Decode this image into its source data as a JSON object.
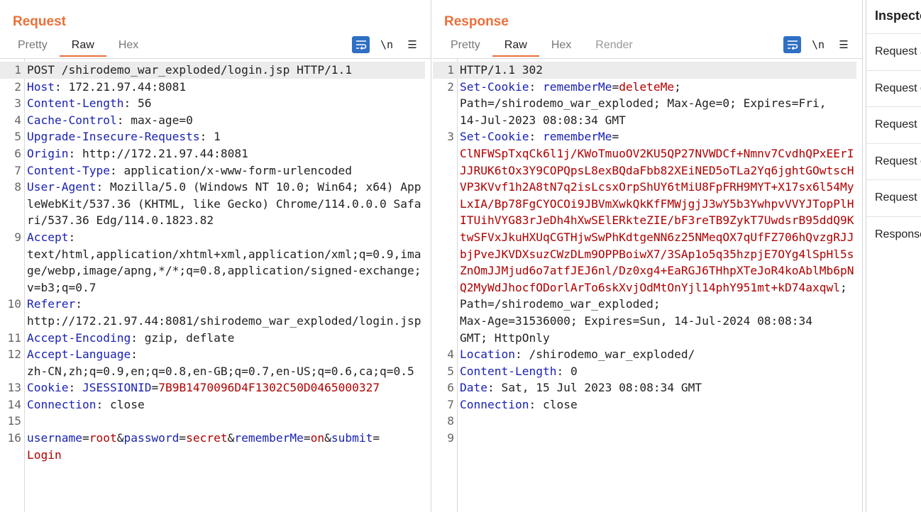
{
  "request": {
    "title": "Request",
    "tabs": [
      "Pretty",
      "Raw",
      "Hex"
    ],
    "active_tab": "Raw",
    "tools": {
      "newline": "\\n",
      "menu": "☰"
    },
    "lines": [
      {
        "n": "1",
        "hl": true,
        "segs": [
          [
            "v",
            "POST /shirodemo_war_exploded/login.jsp HTTP/1.1"
          ]
        ]
      },
      {
        "n": "2",
        "segs": [
          [
            "k",
            "Host"
          ],
          [
            "v",
            ": 172.21.97.44:8081"
          ]
        ]
      },
      {
        "n": "3",
        "segs": [
          [
            "k",
            "Content-Length"
          ],
          [
            "v",
            ": 56"
          ]
        ]
      },
      {
        "n": "4",
        "segs": [
          [
            "k",
            "Cache-Control"
          ],
          [
            "v",
            ": max-age=0"
          ]
        ]
      },
      {
        "n": "5",
        "segs": [
          [
            "k",
            "Upgrade-Insecure-Requests"
          ],
          [
            "v",
            ": 1"
          ]
        ]
      },
      {
        "n": "6",
        "segs": [
          [
            "k",
            "Origin"
          ],
          [
            "v",
            ": http://172.21.97.44:8081"
          ]
        ]
      },
      {
        "n": "7",
        "segs": [
          [
            "k",
            "Content-Type"
          ],
          [
            "v",
            ": application/x-www-form-urlencoded"
          ]
        ]
      },
      {
        "n": "8",
        "segs": [
          [
            "k",
            "User-Agent"
          ],
          [
            "v",
            ": Mozilla/5.0 (Windows NT 10.0; Win64; x64) AppleWebKit/537.36 (KHTML, like Gecko) Chrome/114.0.0.0 Safari/537.36 Edg/114.0.1823.82"
          ]
        ]
      },
      {
        "n": "9",
        "segs": [
          [
            "k",
            "Accept"
          ],
          [
            "v",
            ":\ntext/html,application/xhtml+xml,application/xml;q=0.9,image/webp,image/apng,*/*;q=0.8,application/signed-exchange;v=b3;q=0.7"
          ]
        ]
      },
      {
        "n": "10",
        "segs": [
          [
            "k",
            "Referer"
          ],
          [
            "v",
            ":\nhttp://172.21.97.44:8081/shirodemo_war_exploded/login.jsp"
          ]
        ]
      },
      {
        "n": "11",
        "segs": [
          [
            "k",
            "Accept-Encoding"
          ],
          [
            "v",
            ": gzip, deflate"
          ]
        ]
      },
      {
        "n": "12",
        "segs": [
          [
            "k",
            "Accept-Language"
          ],
          [
            "v",
            ":\nzh-CN,zh;q=0.9,en;q=0.8,en-GB;q=0.7,en-US;q=0.6,ca;q=0.5"
          ]
        ]
      },
      {
        "n": "13",
        "segs": [
          [
            "k",
            "Cookie"
          ],
          [
            "v",
            ": "
          ],
          [
            "k",
            "JSESSIONID"
          ],
          [
            "v",
            "="
          ],
          [
            "r",
            "7B9B1470096D4F1302C50D0465000327"
          ]
        ]
      },
      {
        "n": "14",
        "segs": [
          [
            "k",
            "Connection"
          ],
          [
            "v",
            ": close"
          ]
        ]
      },
      {
        "n": "15",
        "segs": [
          [
            "v",
            ""
          ]
        ]
      },
      {
        "n": "16",
        "segs": [
          [
            "k",
            "username"
          ],
          [
            "v",
            "="
          ],
          [
            "r",
            "root"
          ],
          [
            "v",
            "&"
          ],
          [
            "k",
            "password"
          ],
          [
            "v",
            "="
          ],
          [
            "r",
            "secret"
          ],
          [
            "v",
            "&"
          ],
          [
            "k",
            "rememberMe"
          ],
          [
            "v",
            "="
          ],
          [
            "r",
            "on"
          ],
          [
            "v",
            "&"
          ],
          [
            "k",
            "submit"
          ],
          [
            "v",
            "=\n"
          ],
          [
            "r",
            "Login"
          ]
        ]
      }
    ]
  },
  "response": {
    "title": "Response",
    "tabs": [
      "Pretty",
      "Raw",
      "Hex",
      "Render"
    ],
    "active_tab": "Raw",
    "tools": {
      "newline": "\\n",
      "menu": "☰"
    },
    "lines": [
      {
        "n": "1",
        "hl": true,
        "segs": [
          [
            "v",
            "HTTP/1.1 302"
          ]
        ]
      },
      {
        "n": "2",
        "segs": [
          [
            "k",
            "Set-Cookie"
          ],
          [
            "v",
            ": "
          ],
          [
            "k",
            "rememberMe"
          ],
          [
            "v",
            "="
          ],
          [
            "r",
            "deleteMe"
          ],
          [
            "v",
            ";\nPath=/shirodemo_war_exploded; Max-Age=0; Expires=Fri,\n14-Jul-2023 08:08:34 GMT"
          ]
        ]
      },
      {
        "n": "3",
        "segs": [
          [
            "k",
            "Set-Cookie"
          ],
          [
            "v",
            ": "
          ],
          [
            "k",
            "rememberMe"
          ],
          [
            "v",
            "=\n"
          ],
          [
            "r",
            "ClNFWSpTxqCk6l1j/KWoTmuoOV2KU5QP27NVWDCf+Nmnv7CvdhQPxEErIJJRUK6tOx3Y9COPQpsL8exBQdaFbb82XEiNED5oTLa2Yq6jghtGOwtscHVP3KVvf1h2A8tN7q2isLcsxOrpShUY6tMiU8FpFRH9MYT+X17sx6l54MyLxIA/Bp78FgCYOCOi9JBVmXwkQkKfFMWjgjJ3wY5b3YwhpvVVYJTopPlHITUihVYG83rJeDh4hXwSElERkteZIE/bF3reTB9ZykT7UwdsrB95ddQ9KtwSFVxJkuHXUqCGTHjwSwPhKdtgeNN6z25NMeqOX7qUfFZ706hQvzgRJJbjPveJKVDXsuzCWzDLm9OPPBoiwX7/3SAp1o5q35hzpjE7OYg4lSpHl5sZnOmJJMjud6o7atfJEJ6nl/Dz0xg4+EaRGJ6THhpXTeJoR4koAblMb6pNQ2MyWdJhocfODorlArTo6skXvjOdMtOnYjl14phY951mt+kD74axqwl"
          ],
          [
            "v",
            "; Path=/shirodemo_war_exploded;\nMax-Age=31536000; Expires=Sun, 14-Jul-2024 08:08:34\nGMT; HttpOnly"
          ]
        ]
      },
      {
        "n": "4",
        "segs": [
          [
            "k",
            "Location"
          ],
          [
            "v",
            ": /shirodemo_war_exploded/"
          ]
        ]
      },
      {
        "n": "5",
        "segs": [
          [
            "k",
            "Content-Length"
          ],
          [
            "v",
            ": 0"
          ]
        ]
      },
      {
        "n": "6",
        "segs": [
          [
            "k",
            "Date"
          ],
          [
            "v",
            ": Sat, 15 Jul 2023 08:08:34 GMT"
          ]
        ]
      },
      {
        "n": "7",
        "segs": [
          [
            "k",
            "Connection"
          ],
          [
            "v",
            ": close"
          ]
        ]
      },
      {
        "n": "8",
        "segs": [
          [
            "v",
            ""
          ]
        ]
      },
      {
        "n": "9",
        "segs": [
          [
            "v",
            ""
          ]
        ]
      }
    ]
  },
  "inspector": {
    "title": "Inspector",
    "items": [
      "Request attributes",
      "Request query parameters",
      "Request body parameters",
      "Request cookies",
      "Request headers",
      "Response headers"
    ]
  },
  "colors": {
    "accent": "#e8703a",
    "key": "#1a22b3",
    "value_red": "#b00000",
    "button_blue": "#2f6fc4"
  }
}
